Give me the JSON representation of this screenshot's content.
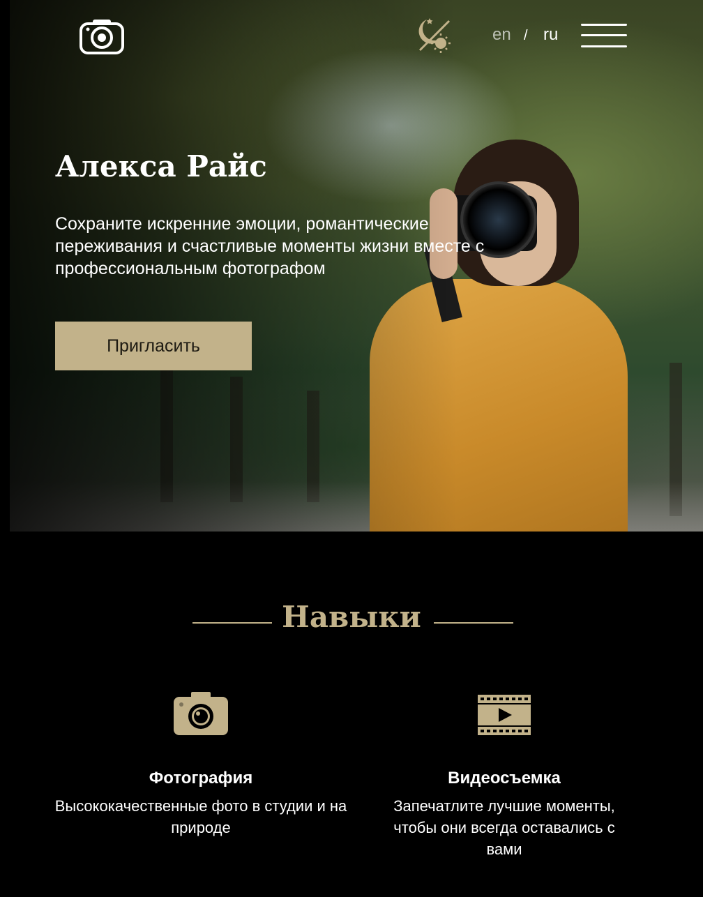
{
  "header": {
    "logo_icon": "camera-logo-icon",
    "theme_icon": "sun-moon-icon",
    "lang_en": "en",
    "lang_separator": "/",
    "lang_ru": "ru",
    "menu_icon": "hamburger-menu-icon",
    "active_language": "ru"
  },
  "hero": {
    "title": "Алекса Райс",
    "text": "Сохраните искренние эмоции, романтические переживания и счастливые моменты жизни вместе с профессиональным фотографом",
    "button_label": "Пригласить"
  },
  "skills": {
    "title": "Навыки",
    "items": [
      {
        "icon": "photo-camera-icon",
        "name": "Фотография",
        "description": "Высококачественные фото в студии и на природе"
      },
      {
        "icon": "video-film-icon",
        "name": "Видеосъемка",
        "description": "Запечатлите лучшие моменты, чтобы они всегда оставались с вами"
      }
    ]
  },
  "colors": {
    "accent": "#c2b28a",
    "background": "#000000",
    "text": "#ffffff"
  }
}
